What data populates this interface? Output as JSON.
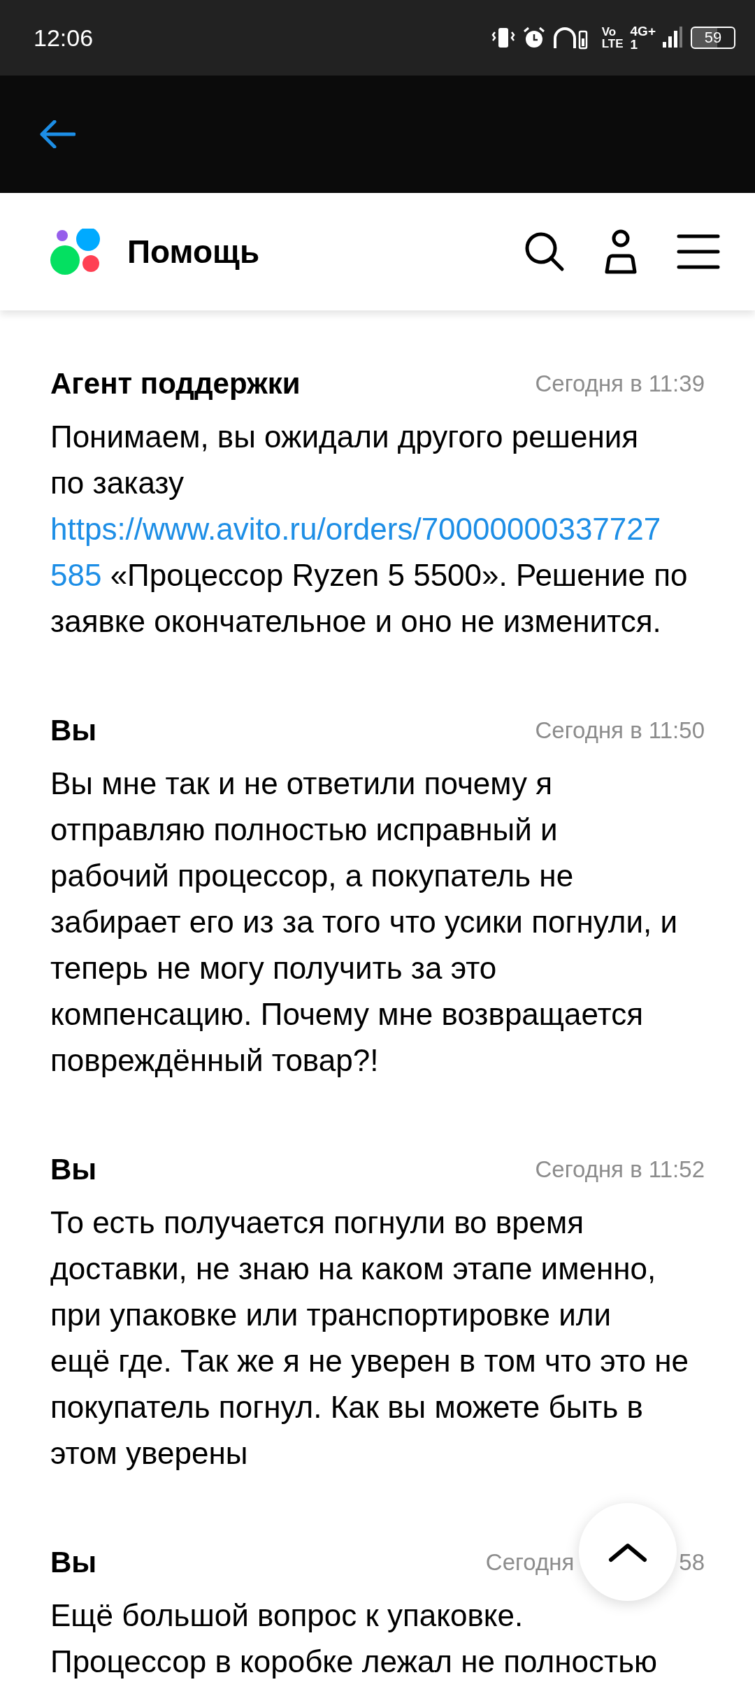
{
  "status_bar": {
    "time": "12:06",
    "volte": [
      "Vo",
      "LTE"
    ],
    "network": "4G+",
    "sim": "1",
    "battery": "59"
  },
  "header": {
    "title": "Помощь"
  },
  "messages": [
    {
      "author": "Агент поддержки",
      "time": "Сегодня в 11:39",
      "lines": [
        [
          {
            "kind": "text",
            "text": "Понимаем, вы ожидали другого решения"
          }
        ],
        [
          {
            "kind": "text",
            "text": "по заказу"
          }
        ],
        [
          {
            "kind": "link",
            "text": "https://www.avito.ru/orders/70000000337727"
          }
        ],
        [
          {
            "kind": "link",
            "text": "585"
          },
          {
            "kind": "text",
            "text": " «Процессор Ryzen 5 5500». Решение по"
          }
        ],
        [
          {
            "kind": "text",
            "text": "заявке окончательное и оно не изменится."
          }
        ]
      ]
    },
    {
      "author": "Вы",
      "time": "Сегодня в 11:50",
      "lines": [
        [
          {
            "kind": "text",
            "text": "Вы мне так и не ответили почему я"
          }
        ],
        [
          {
            "kind": "text",
            "text": "отправляю полностью исправный и"
          }
        ],
        [
          {
            "kind": "text",
            "text": "рабочий процессор, а покупатель не"
          }
        ],
        [
          {
            "kind": "text",
            "text": "забирает его из за того что усики погнули, и"
          }
        ],
        [
          {
            "kind": "text",
            "text": "теперь не могу получить за это"
          }
        ],
        [
          {
            "kind": "text",
            "text": "компенсацию. Почему мне возвращается"
          }
        ],
        [
          {
            "kind": "text",
            "text": "повреждённый товар?!"
          }
        ]
      ]
    },
    {
      "author": "Вы",
      "time": "Сегодня в 11:52",
      "lines": [
        [
          {
            "kind": "text",
            "text": "То есть получается погнули во время"
          }
        ],
        [
          {
            "kind": "text",
            "text": "доставки, не знаю на каком этапе именно,"
          }
        ],
        [
          {
            "kind": "text",
            "text": "при упаковке или транспортировке или"
          }
        ],
        [
          {
            "kind": "text",
            "text": "ещё где. Так же я не уверен в том что это не"
          }
        ],
        [
          {
            "kind": "text",
            "text": "покупатель погнул. Как вы можете быть в"
          }
        ],
        [
          {
            "kind": "text",
            "text": "этом уверены"
          }
        ]
      ]
    },
    {
      "author": "Вы",
      "time_parts": [
        "Сегодня",
        "58"
      ],
      "lines": [
        [
          {
            "kind": "text",
            "text": "Ещё большой вопрос к упаковке."
          }
        ],
        [
          {
            "kind": "text",
            "text": "Процессор в коробке лежал не полностью"
          }
        ]
      ]
    }
  ]
}
